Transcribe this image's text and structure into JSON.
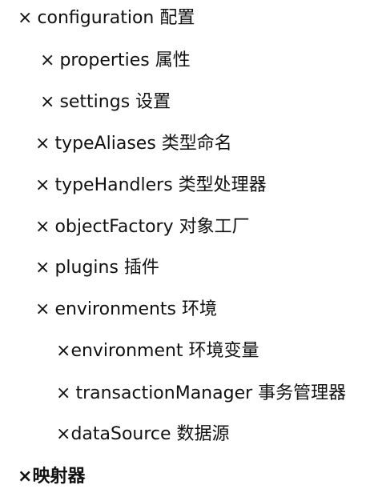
{
  "items": [
    {
      "mark": "×",
      "text": "configuration 配置"
    },
    {
      "mark": "×",
      "text": "properties 属性"
    },
    {
      "mark": "×",
      "text": "settings 设置"
    },
    {
      "mark": "×",
      "text": "typeAliases 类型命名"
    },
    {
      "mark": "×",
      "text": "typeHandlers 类型处理器"
    },
    {
      "mark": "×",
      "text": "objectFactory 对象工厂"
    },
    {
      "mark": "×",
      "text": "plugins 插件"
    },
    {
      "mark": "×",
      "text": "environments 环境"
    },
    {
      "mark": "×",
      "text": "environment 环境变量"
    },
    {
      "mark": "×",
      "text": "transactionManager 事务管理器"
    },
    {
      "mark": "×",
      "text": "dataSource 数据源"
    },
    {
      "mark": "×",
      "text": "映射器"
    }
  ]
}
